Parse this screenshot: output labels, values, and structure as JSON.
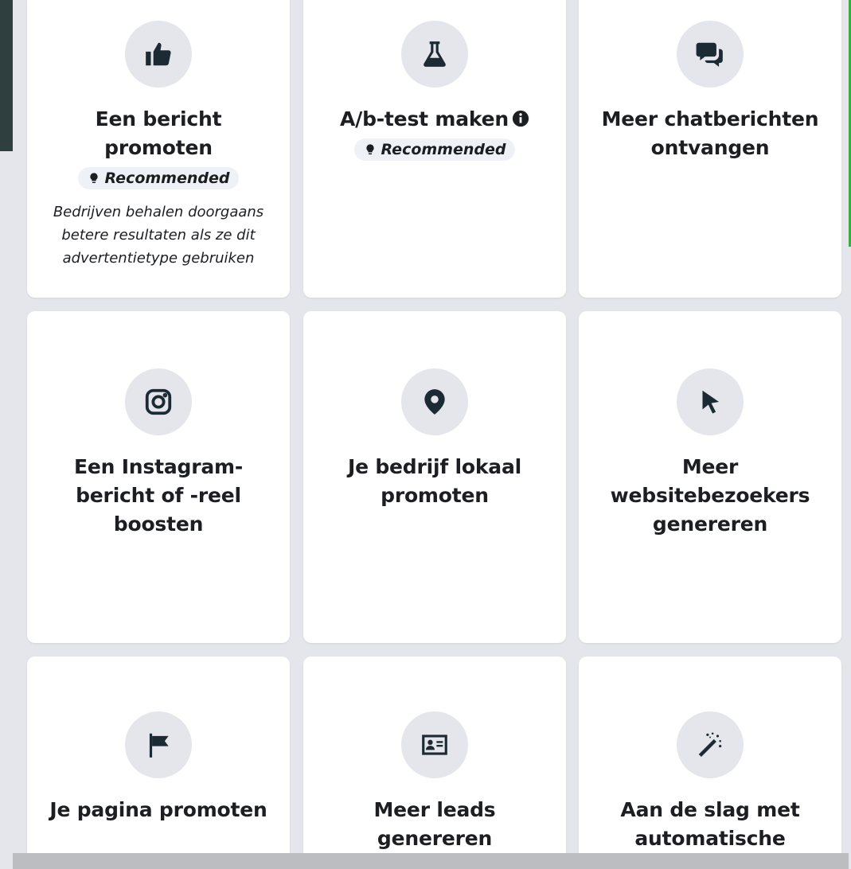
{
  "cards": [
    {
      "icon": "thumbs-up-icon",
      "title": "Een bericht promoten",
      "badge": "Recommended",
      "description": "Bedrijven behalen doorgaans betere resultaten als ze dit advertentietype gebruiken"
    },
    {
      "icon": "flask-icon",
      "title": "A/b-test maken",
      "badge": "Recommended",
      "has_info": true
    },
    {
      "icon": "chat-bubbles-icon",
      "title": "Meer chatberichten ontvangen"
    },
    {
      "icon": "instagram-icon",
      "title": "Een Instagram-bericht of -reel boosten"
    },
    {
      "icon": "location-pin-icon",
      "title": "Je bedrijf lokaal promoten"
    },
    {
      "icon": "cursor-icon",
      "title": "Meer websitebezoekers genereren"
    },
    {
      "icon": "flag-icon",
      "title": "Je pagina promoten"
    },
    {
      "icon": "contact-card-icon",
      "title": "Meer leads genereren"
    },
    {
      "icon": "magic-wand-icon",
      "title": "Aan de slag met automatische"
    }
  ],
  "colors": {
    "panel_bg": "#e4e6eb",
    "card_bg": "#ffffff",
    "icon_circle": "#e4e6eb",
    "icon_fill": "#1c2b33",
    "badge_bg": "#eef2f7"
  }
}
